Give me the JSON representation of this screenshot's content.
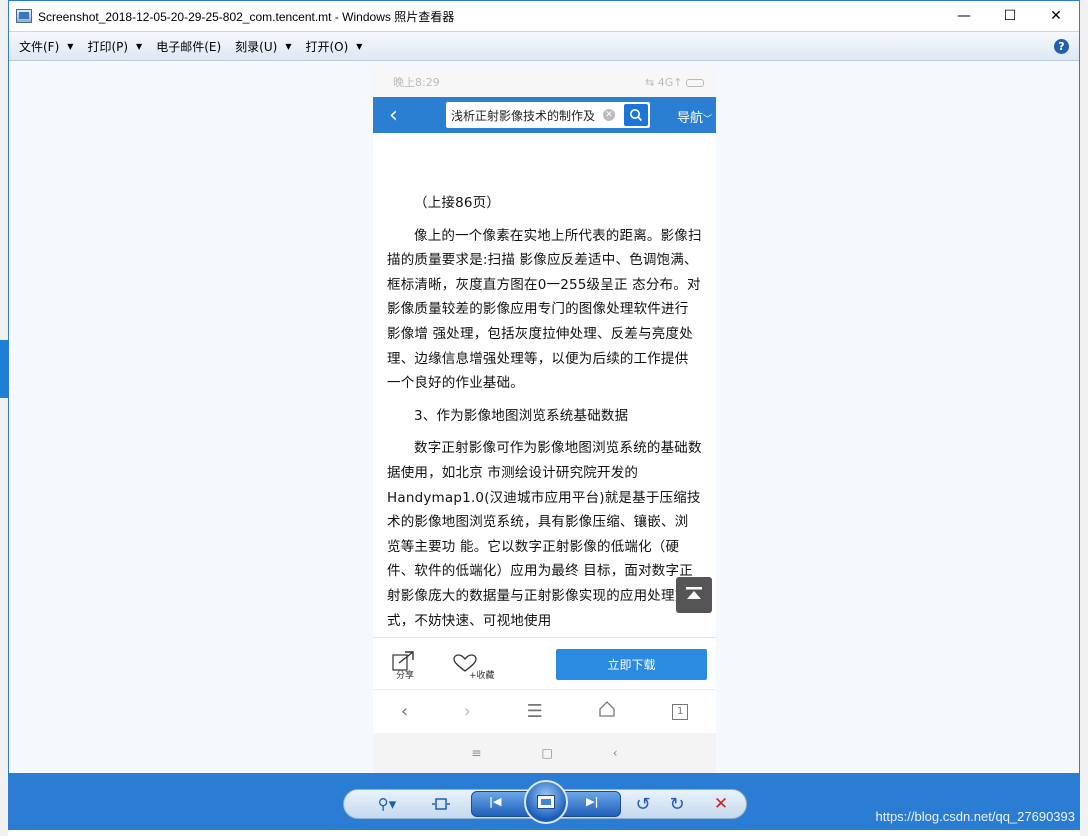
{
  "window": {
    "title": "Screenshot_2018-12-05-20-29-25-802_com.tencent.mt - Windows 照片查看器",
    "minimize": "—",
    "maximize": "☐",
    "close": "✕"
  },
  "menu": {
    "items": [
      {
        "label": "文件(F)",
        "caret": true
      },
      {
        "label": "打印(P)",
        "caret": true
      },
      {
        "label": "电子邮件(E)",
        "caret": false
      },
      {
        "label": "刻录(U)",
        "caret": true
      },
      {
        "label": "打开(O)",
        "caret": true
      }
    ],
    "help": "?"
  },
  "phone": {
    "status_time": "晚上8:29",
    "status_right": "⇆ 4G↑",
    "search_text": "浅析正射影像技术的制作及",
    "nav_label": "导航",
    "article": [
      "（上接86页）",
      "像上的一个像素在实地上所代表的距离。影像扫描的质量要求是:扫描 影像应反差适中、色调饱满、框标清晰，灰度直方图在0一255级呈正 态分布。对影像质量较差的影像应用专门的图像处理软件进行影像增 强处理，包括灰度拉伸处理、反差与亮度处理、边缘信息增强处理等，以便为后续的工作提供一个良好的作业基础。",
      "3、作为影像地图浏览系统基础数据",
      "数字正射影像可作为影像地图浏览系统的基础数据使用，如北京 市测绘设计研究院开发的Handymap1.0(汉迪城市应用平台)就是基于压缩技术的影像地图浏览系统，具有影像压缩、镶嵌、浏览等主要功 能。它以数字正射影像的低端化（硬件、软件的低端化）应用为最终 目标，面对数字正射影像庞大的数据量与正射影像实现的应用处理方式，不妨快速、可视地使用"
    ],
    "share_label": "分享",
    "fav_label": "+收藏",
    "download_label": "立即下载",
    "tab_count": "1"
  },
  "toolbar": {
    "zoom_label": "⚲▾",
    "watermark": "https://blog.csdn.net/qq_27690393"
  }
}
